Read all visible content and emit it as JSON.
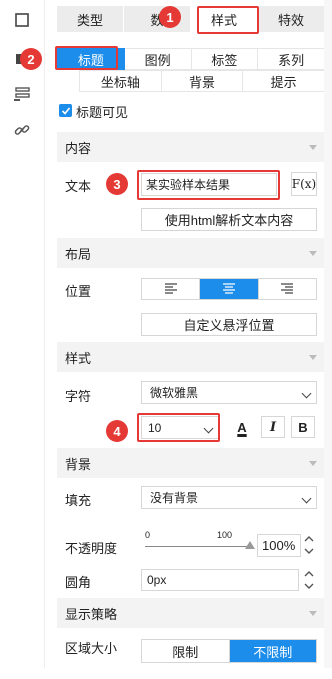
{
  "tabs": [
    "类型",
    "数",
    "样式",
    "特效"
  ],
  "subtabs_row1": [
    "标题",
    "图例",
    "标签",
    "系列"
  ],
  "subtabs_row2": [
    "坐标轴",
    "背景",
    "提示"
  ],
  "title_visible_label": "标题可见",
  "sections": {
    "content": "内容",
    "layout": "布局",
    "style": "样式",
    "background": "背景",
    "strategy": "显示策略"
  },
  "content": {
    "text_label": "文本",
    "text_value": "某实验样本结果",
    "fx_label": "F(x)",
    "html_button": "使用html解析文本内容"
  },
  "layout": {
    "position_label": "位置",
    "custom_position_button": "自定义悬浮位置"
  },
  "style": {
    "font_label": "字符",
    "font_value": "微软雅黑",
    "size_value": "10",
    "bold_label": "B",
    "italic_label": "I",
    "color_label": "A"
  },
  "background": {
    "fill_label": "填充",
    "fill_value": "没有背景",
    "opacity_label": "不透明度",
    "slider_min": "0",
    "slider_max": "100",
    "opacity_value": "100%",
    "radius_label": "圆角",
    "radius_value": "0px"
  },
  "strategy": {
    "area_label": "区域大小",
    "options": [
      "限制",
      "不限制"
    ]
  },
  "badges": [
    "1",
    "2",
    "3",
    "4"
  ],
  "colors": {
    "accent": "#1c8dea",
    "callout": "#e53935"
  }
}
